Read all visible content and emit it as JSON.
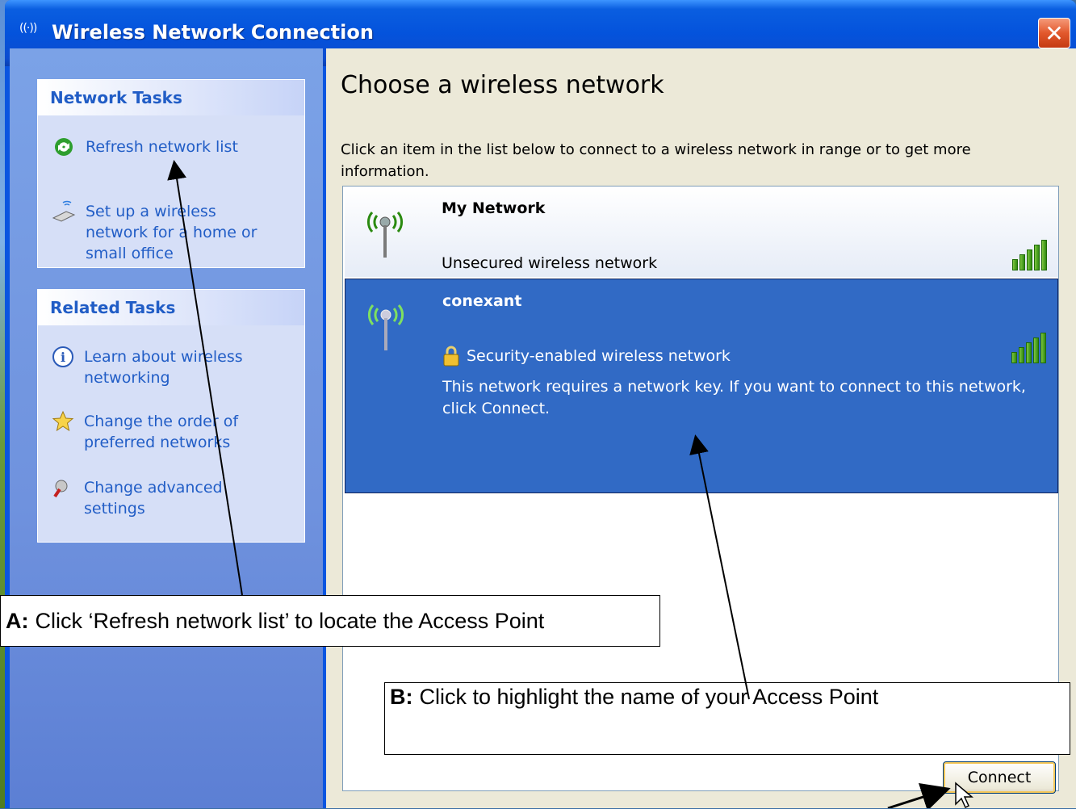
{
  "window": {
    "title": "Wireless Network Connection",
    "title_icon": "wireless-icon",
    "close_label": "✕"
  },
  "sidebar": {
    "network_tasks": {
      "heading": "Network Tasks",
      "items": [
        {
          "label": "Refresh network list",
          "icon": "refresh-icon"
        },
        {
          "label": "Set up a wireless network for a home or small office",
          "icon": "wireless-setup-icon"
        }
      ]
    },
    "related_tasks": {
      "heading": "Related Tasks",
      "items": [
        {
          "label": "Learn about wireless networking",
          "icon": "info-icon"
        },
        {
          "label": "Change the order of preferred networks",
          "icon": "star-icon"
        },
        {
          "label": "Change advanced settings",
          "icon": "settings-icon"
        }
      ]
    }
  },
  "main": {
    "heading": "Choose a wireless network",
    "instructions": "Click an item in the list below to connect to a wireless network in range or to get more information.",
    "networks": [
      {
        "name": "My Network",
        "status": "Unsecured wireless network",
        "signal_bars": 5,
        "selected": false
      },
      {
        "name": "conexant",
        "status": "Security-enabled wireless network",
        "description": "This network requires a network key. If you want to connect to this network, click Connect.",
        "signal_bars": 5,
        "selected": true,
        "secured": true
      }
    ],
    "connect_label": "Connect"
  },
  "annotations": {
    "a": {
      "prefix": "A:",
      "text": "Click ‘Refresh network list’ to locate the  Access Point"
    },
    "b": {
      "prefix": "B:",
      "text": "Click to highlight the name of your Access Point"
    }
  },
  "colors": {
    "titlebar": "#0453dc",
    "sidebar": "#6f92de",
    "selection": "#316ac5",
    "link": "#215dc6"
  }
}
